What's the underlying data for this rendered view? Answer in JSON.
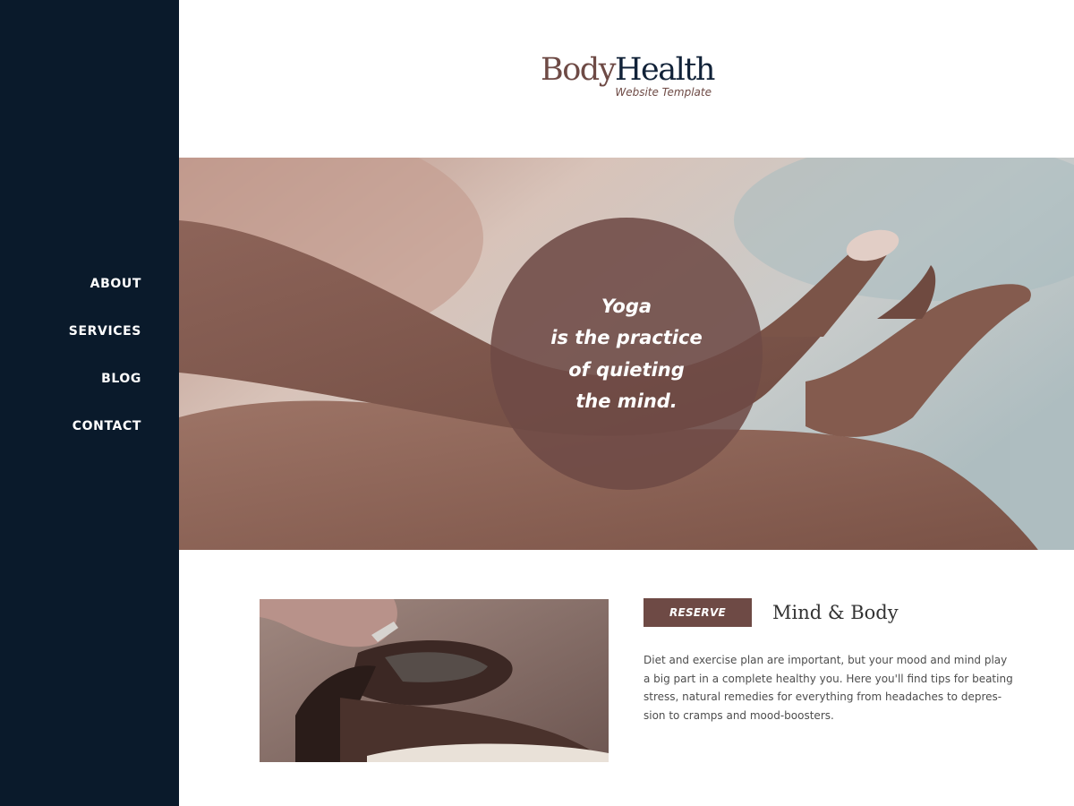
{
  "nav": {
    "items": [
      {
        "label": "ABOUT"
      },
      {
        "label": "SERVICES"
      },
      {
        "label": "BLOG"
      },
      {
        "label": "CONTACT"
      }
    ]
  },
  "logo": {
    "part1": "Body",
    "part2": "Health",
    "tagline": "Website Template"
  },
  "hero": {
    "quote_lines": [
      "Yoga",
      "is the practice",
      "of quieting",
      "the mind."
    ]
  },
  "feature": {
    "button_label": "RESERVE",
    "title": "Mind & Body",
    "body_lines": [
      "Diet and exercise plan are important, but your mood and mind play",
      "a big part in a complete healthy you. Here you'll find tips for beating",
      "stress, natural remedies for everything from headaches to depres-",
      "sion to cramps and mood-boosters."
    ]
  },
  "colors": {
    "sidebar": "#0a1a2b",
    "accent": "#6e4a45",
    "logo_dark": "#112238"
  }
}
